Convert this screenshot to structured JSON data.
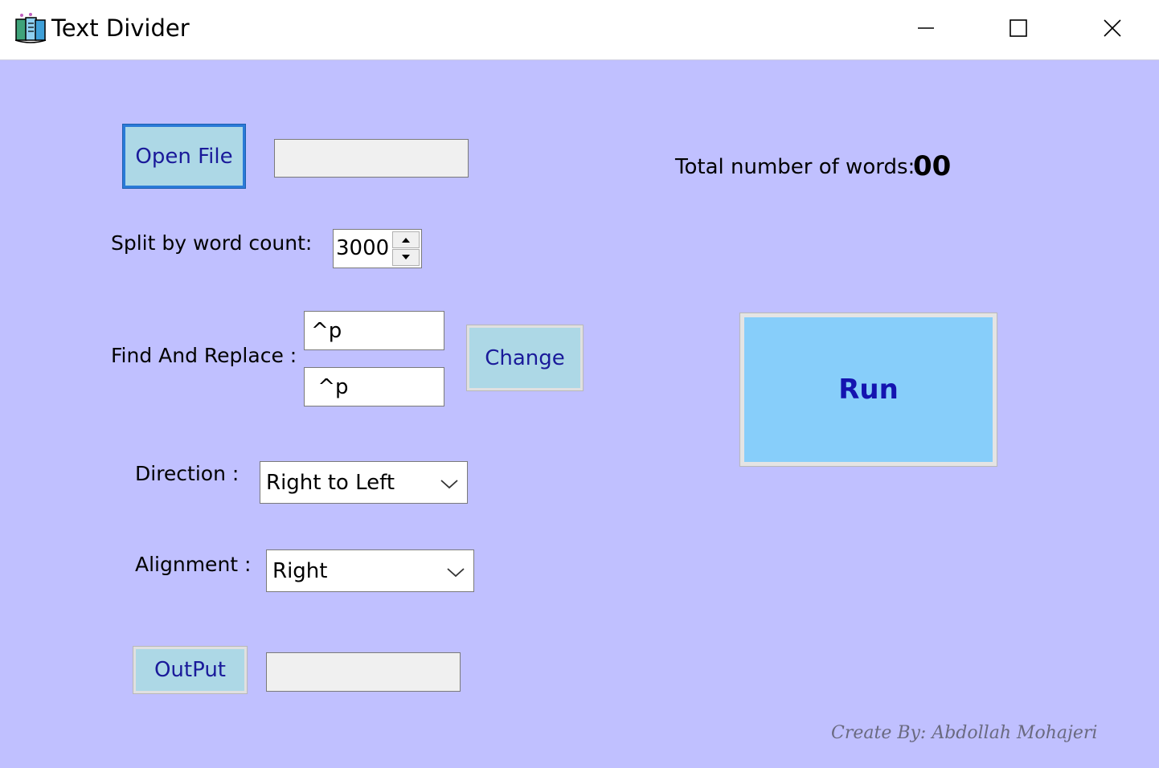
{
  "window": {
    "title": "Text Divider",
    "icon": "books-icon",
    "controls": [
      "minimize-icon",
      "maximize-icon",
      "close-icon"
    ]
  },
  "open_file": {
    "button_label": "Open File",
    "path_value": ""
  },
  "word_total": {
    "label": "Total number of words:",
    "value": "00"
  },
  "split": {
    "label": "Split by word count:",
    "value": "3000"
  },
  "find_replace": {
    "label": "Find And Replace :",
    "find_value": "^p",
    "replace_value": " ^p",
    "change_label": "Change"
  },
  "direction": {
    "label": "Direction :",
    "selected": "Right to Left"
  },
  "alignment": {
    "label": "Alignment :",
    "selected": "Right"
  },
  "output": {
    "button_label": "OutPut",
    "path_value": ""
  },
  "run": {
    "label": "Run"
  },
  "credit": {
    "text": "Create By: Abdollah Mohajeri"
  },
  "colors": {
    "background": "#c0c0ff",
    "button": "#add8e6",
    "button_text": "#1a1a9a"
  }
}
